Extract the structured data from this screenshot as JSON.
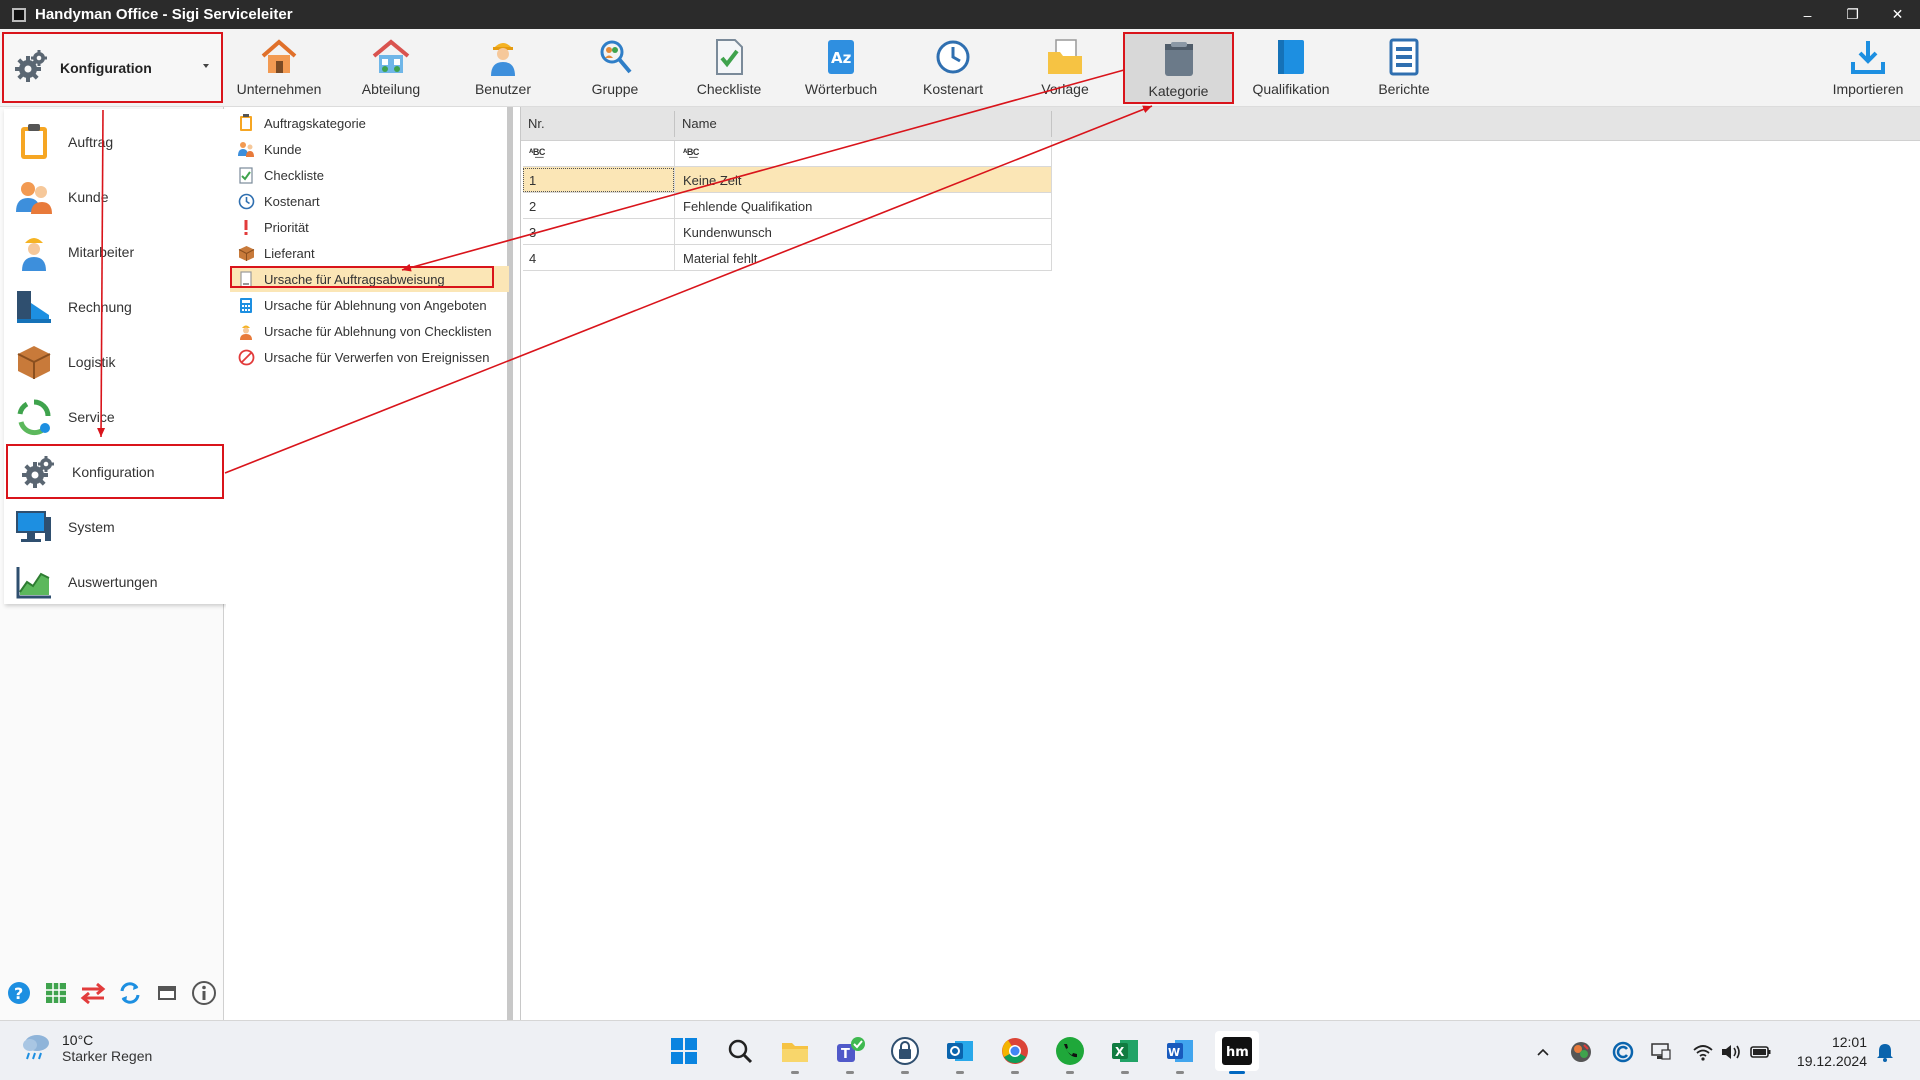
{
  "window": {
    "title": "Handyman Office - Sigi Serviceleiter",
    "controls": [
      "–",
      "❐",
      "✕"
    ]
  },
  "ribbon": {
    "module_selector": "Konfiguration",
    "buttons": [
      {
        "label": "Unternehmen",
        "icon": "house-icon"
      },
      {
        "label": "Abteilung",
        "icon": "department-house-icon"
      },
      {
        "label": "Benutzer",
        "icon": "user-worker-icon"
      },
      {
        "label": "Gruppe",
        "icon": "group-magnifier-icon"
      },
      {
        "label": "Checkliste",
        "icon": "checklist-icon"
      },
      {
        "label": "Wörterbuch",
        "icon": "dictionary-icon"
      },
      {
        "label": "Kostenart",
        "icon": "clock-icon"
      },
      {
        "label": "Vorlage",
        "icon": "template-folder-icon"
      },
      {
        "label": "Kategorie",
        "icon": "category-book-icon"
      },
      {
        "label": "Qualifikation",
        "icon": "qualification-book-icon"
      },
      {
        "label": "Berichte",
        "icon": "report-icon"
      }
    ],
    "import_label": "Importieren",
    "active": "Kategorie"
  },
  "nav": {
    "items": [
      {
        "label": "Auftrag",
        "icon": "clipboard-icon"
      },
      {
        "label": "Kunde",
        "icon": "customers-icon"
      },
      {
        "label": "Mitarbeiter",
        "icon": "worker-icon"
      },
      {
        "label": "Rechnung",
        "icon": "invoice-icon"
      },
      {
        "label": "Logistik",
        "icon": "package-icon"
      },
      {
        "label": "Service",
        "icon": "service-recycle-icon"
      },
      {
        "label": "Konfiguration",
        "icon": "gear-icon"
      },
      {
        "label": "System",
        "icon": "computer-icon"
      },
      {
        "label": "Auswertungen",
        "icon": "chart-icon"
      }
    ],
    "selected": "Konfiguration",
    "bottom_icons": [
      "help-icon",
      "grid-icon",
      "swap-arrows-icon",
      "refresh-icon",
      "window-icon",
      "info-icon"
    ]
  },
  "categories": {
    "items": [
      {
        "label": "Auftragskategorie",
        "icon": "clipboard-small-icon"
      },
      {
        "label": "Kunde",
        "icon": "customers-small-icon"
      },
      {
        "label": "Checkliste",
        "icon": "checklist-small-icon"
      },
      {
        "label": "Kostenart",
        "icon": "clock-small-icon"
      },
      {
        "label": "Priorität",
        "icon": "exclamation-icon"
      },
      {
        "label": "Lieferant",
        "icon": "package-small-icon"
      },
      {
        "label": "Ursache für Auftragsabweisung",
        "icon": "document-small-icon"
      },
      {
        "label": "Ursache für Ablehnung von Angeboten",
        "icon": "calculator-small-icon"
      },
      {
        "label": "Ursache für Ablehnung von Checklisten",
        "icon": "worker-small-icon"
      },
      {
        "label": "Ursache für Verwerfen von Ereignissen",
        "icon": "prohibited-icon"
      }
    ],
    "selected": "Ursache für Auftragsabweisung"
  },
  "grid": {
    "headers": {
      "nr": "Nr.",
      "name": "Name"
    },
    "filter_placeholder": "ᴬB͟C",
    "rows": [
      {
        "nr": "1",
        "name": "Keine Zeit"
      },
      {
        "nr": "2",
        "name": "Fehlende Qualifikation"
      },
      {
        "nr": "3",
        "name": "Kundenwunsch"
      },
      {
        "nr": "4",
        "name": "Material fehlt"
      }
    ],
    "selected_row": 0
  },
  "taskbar": {
    "weather": {
      "temp": "10°C",
      "condition": "Starker Regen"
    },
    "apps": [
      "windows-start-icon",
      "search-icon",
      "file-explorer-icon",
      "teams-icon",
      "keepass-icon",
      "outlook-icon",
      "chrome-icon",
      "phone-icon",
      "excel-icon",
      "word-icon",
      "handyman-icon"
    ],
    "active_app": "handyman-icon",
    "tray": [
      "chevron-up-icon",
      "avatar-icon",
      "copilot-icon",
      "display-icon",
      "wifi-icon",
      "volume-icon",
      "battery-icon"
    ],
    "time": "12:01",
    "date": "19.12.2024",
    "notification_icon": "bell-icon"
  },
  "colors": {
    "highlight_red": "#d9141b",
    "selection": "#fbe6b6",
    "accent_blue": "#1f8fe5"
  }
}
